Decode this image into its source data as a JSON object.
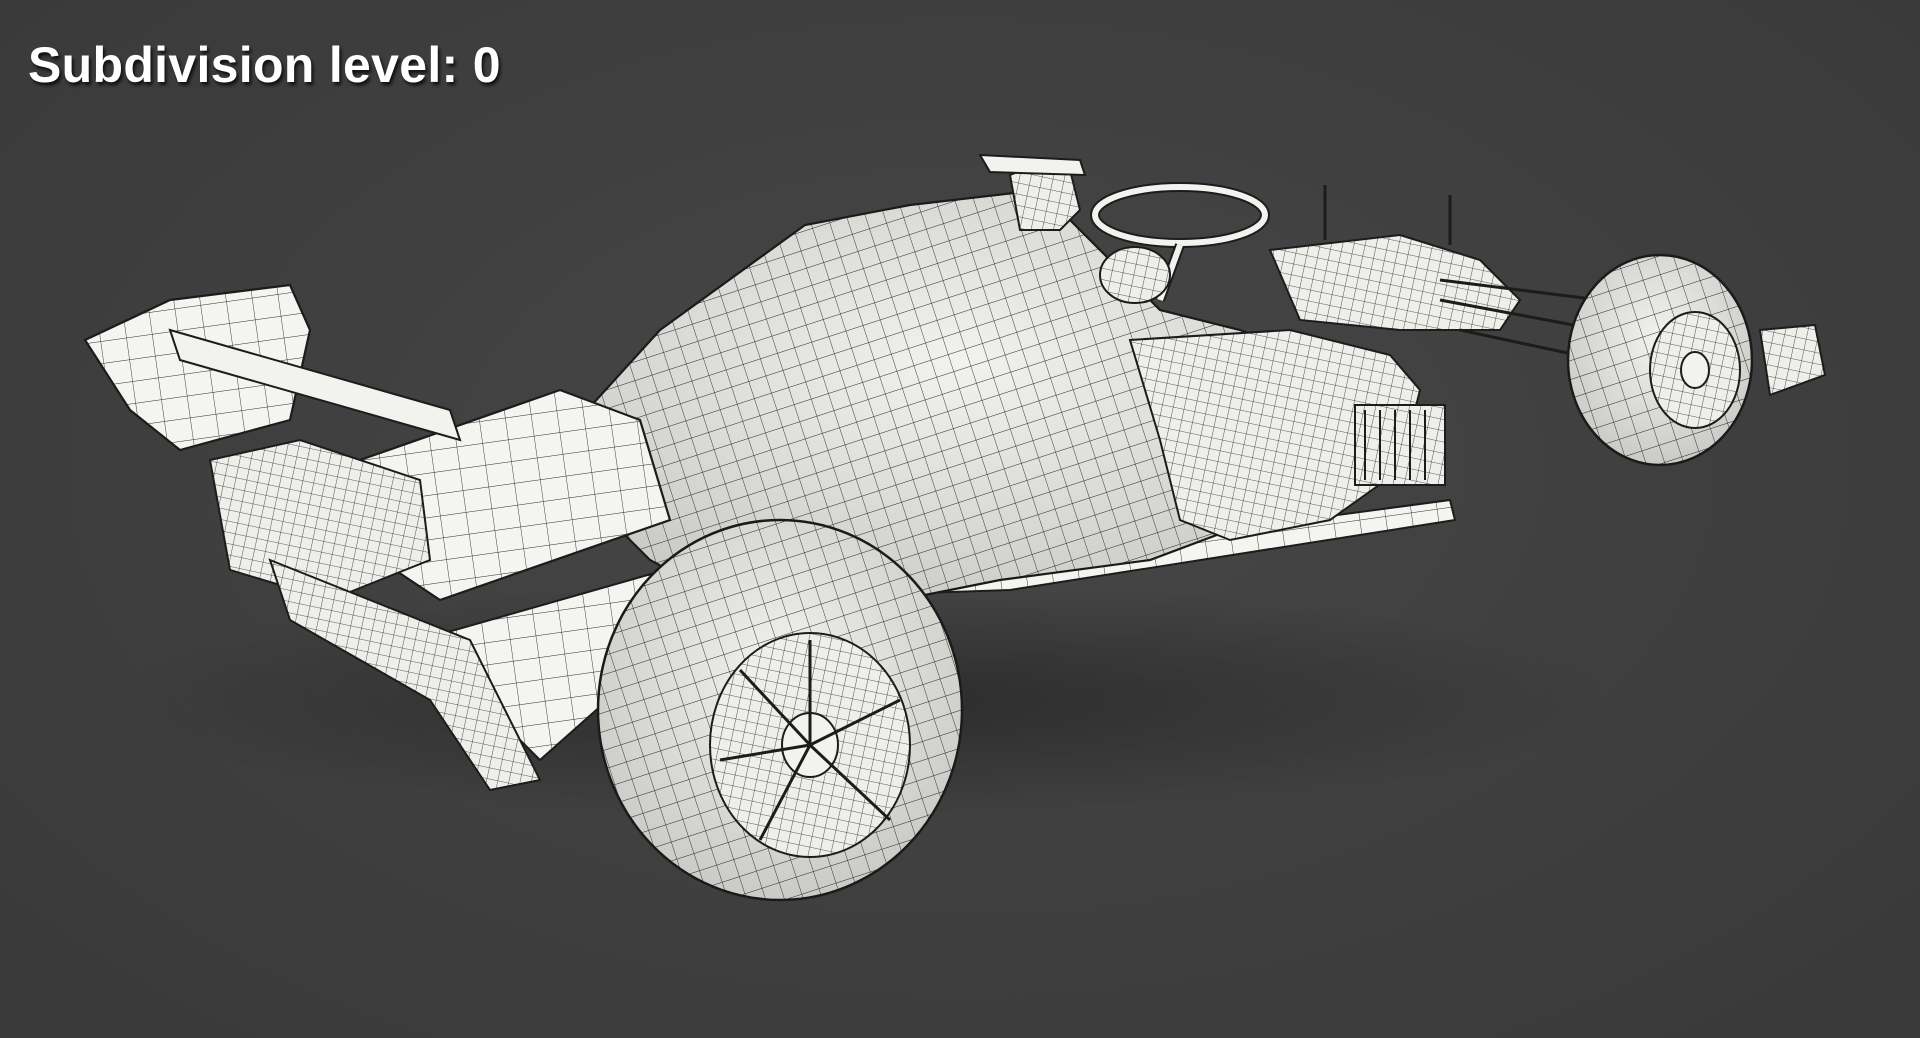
{
  "overlay": {
    "label": "Subdivision level: 0"
  },
  "model": {
    "subject": "formula-1-car-wireframe",
    "shading": "clay-with-wireframe"
  },
  "colors": {
    "background": "#3f3f3f",
    "surface": "#f2f2ee",
    "wire": "#1c1c1c",
    "label": "#ffffff"
  }
}
